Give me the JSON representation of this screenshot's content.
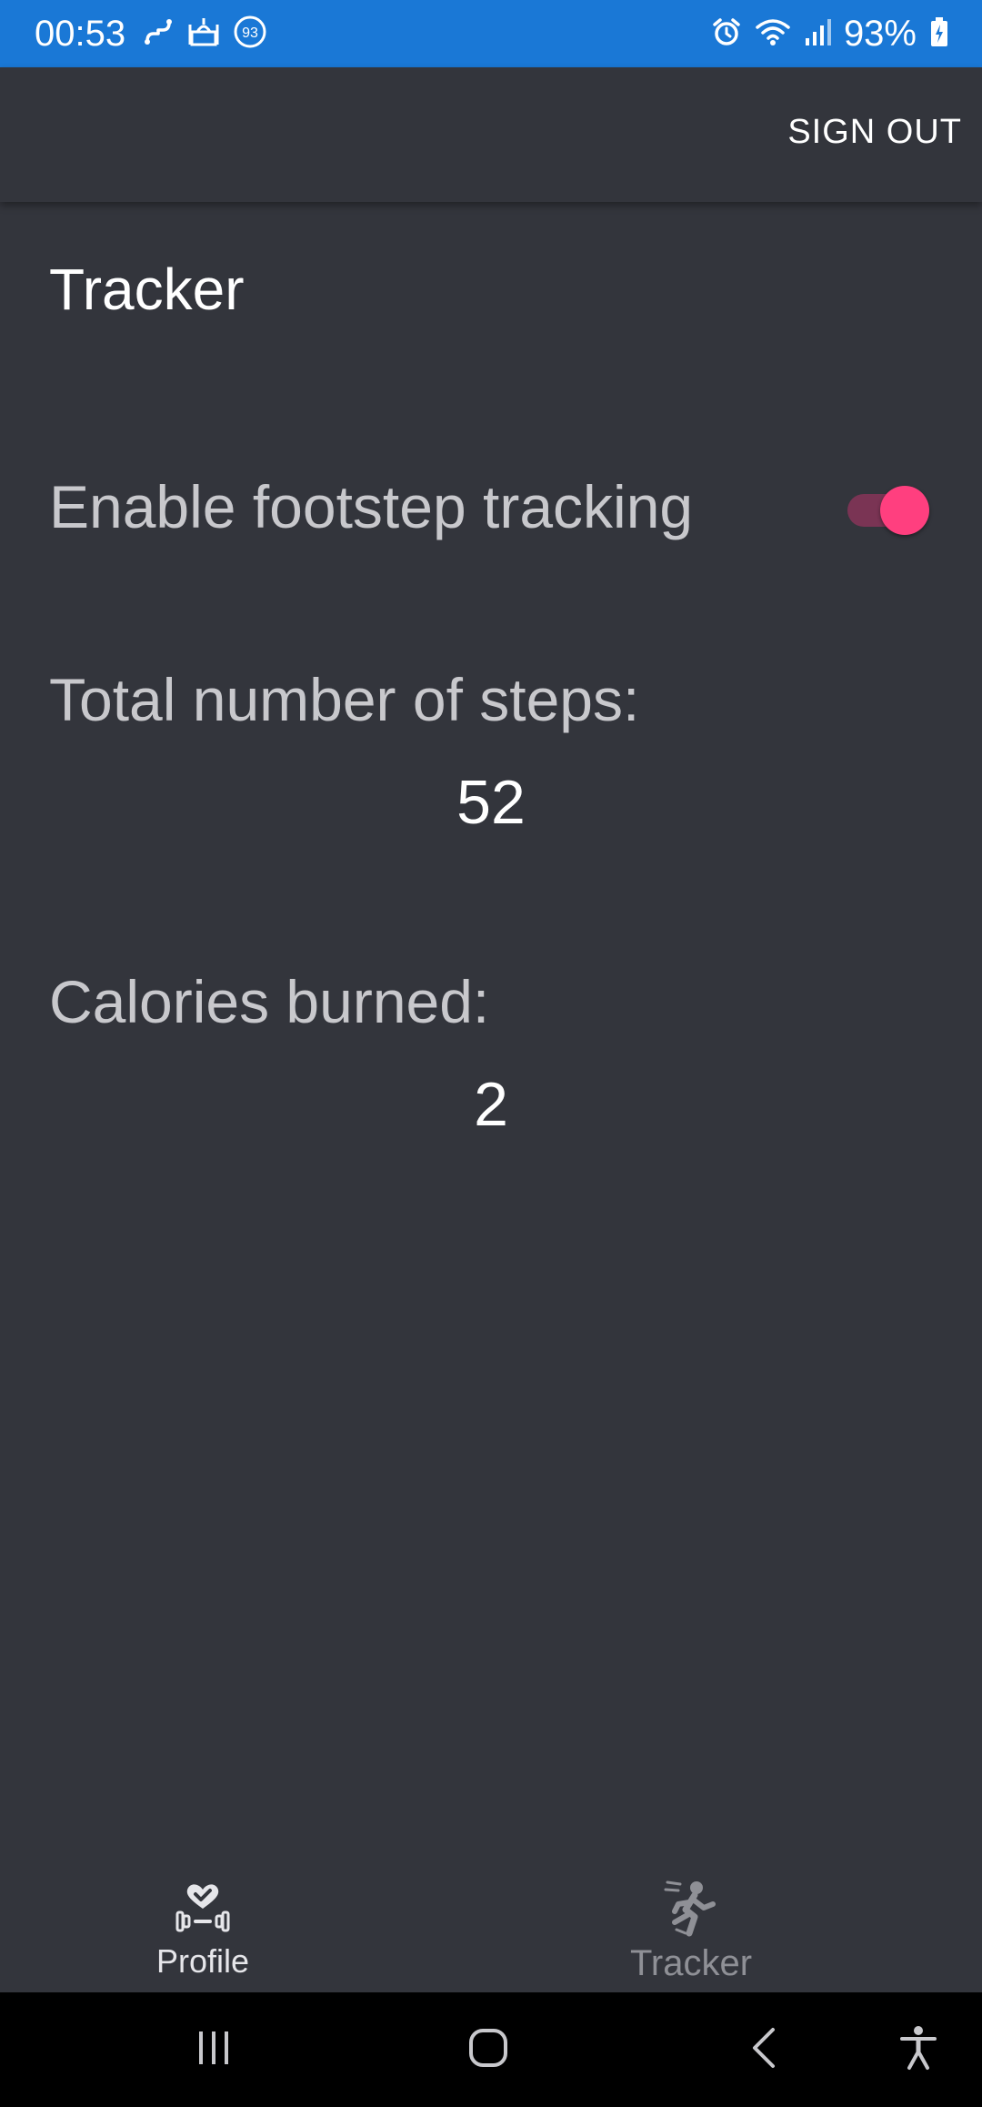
{
  "status_bar": {
    "time": "00:53",
    "notification_badge": "93",
    "battery_percent": "93%",
    "icons": [
      "link-icon",
      "mosque-icon",
      "badge-icon",
      "alarm-icon",
      "wifi-icon",
      "signal-icon",
      "battery-charging-icon"
    ]
  },
  "app_bar": {
    "sign_out_label": "SIGN OUT"
  },
  "page": {
    "title": "Tracker"
  },
  "settings": {
    "footstep_tracking_label": "Enable footstep tracking",
    "footstep_tracking_enabled": true
  },
  "stats": {
    "steps_label": "Total number of steps:",
    "steps_value": "52",
    "calories_label": "Calories burned:",
    "calories_value": "2"
  },
  "bottom_nav": {
    "items": [
      {
        "label": "Profile",
        "icon": "heart-dumbbell-icon"
      },
      {
        "label": "Tracker",
        "icon": "running-person-icon"
      }
    ]
  },
  "colors": {
    "status_bar": "#1a78d6",
    "background": "#33353c",
    "accent": "#ff3f7f",
    "switch_track": "#7a3454",
    "text_primary": "#ffffff",
    "text_secondary": "#c8c8cc",
    "nav_inactive": "#8f9096"
  }
}
